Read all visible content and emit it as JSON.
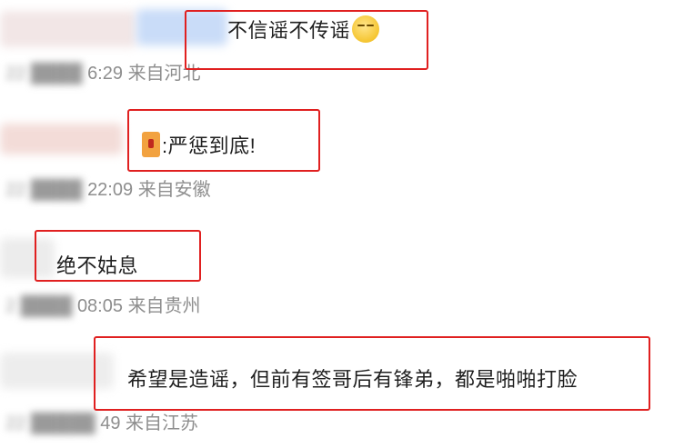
{
  "comments": [
    {
      "text": "不信谣不传谣",
      "emoji": "smiling-face-emoji",
      "time": "6:29",
      "time_prefix": "22",
      "location": "来自河北"
    },
    {
      "text": ":严惩到底!",
      "icon": "badge-icon",
      "time": "22:09",
      "time_prefix": "22",
      "location": "来自安徽"
    },
    {
      "text": "绝不姑息",
      "time": "08:05",
      "time_prefix": "2",
      "location": "来自贵州"
    },
    {
      "text": "希望是造谣，但前有签哥后有锋弟，都是啪啪打脸",
      "time": "49",
      "time_prefix": "22",
      "location": "来自江苏"
    }
  ],
  "colors": {
    "highlight_box": "#e02020",
    "meta_text": "#8e8e8e",
    "comment_text": "#1f1f1f"
  }
}
